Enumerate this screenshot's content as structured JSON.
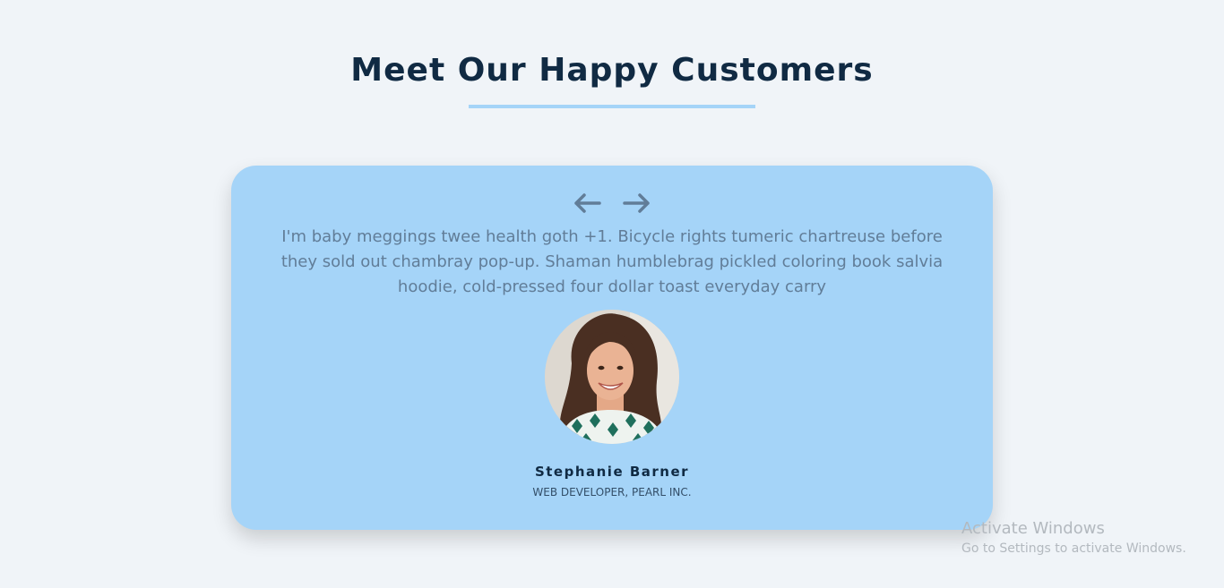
{
  "section": {
    "title": "Meet Our Happy Customers"
  },
  "testimonial": {
    "prev_icon": "arrow-left-icon",
    "next_icon": "arrow-right-icon",
    "quote": "I'm baby meggings twee health goth +1. Bicycle rights tumeric chartreuse before they sold out chambray pop-up. Shaman humblebrag pickled coloring book salvia hoodie, cold-pressed four dollar toast everyday carry",
    "name": "Stephanie Barner",
    "role": "web developer, pearl inc."
  },
  "watermark": {
    "title": "Activate Windows",
    "subtitle": "Go to Settings to activate Windows."
  },
  "colors": {
    "background": "#f0f4f8",
    "card": "#a5d4f8",
    "heading": "#102a43",
    "quote": "#617d98",
    "arrow": "#617d98"
  }
}
